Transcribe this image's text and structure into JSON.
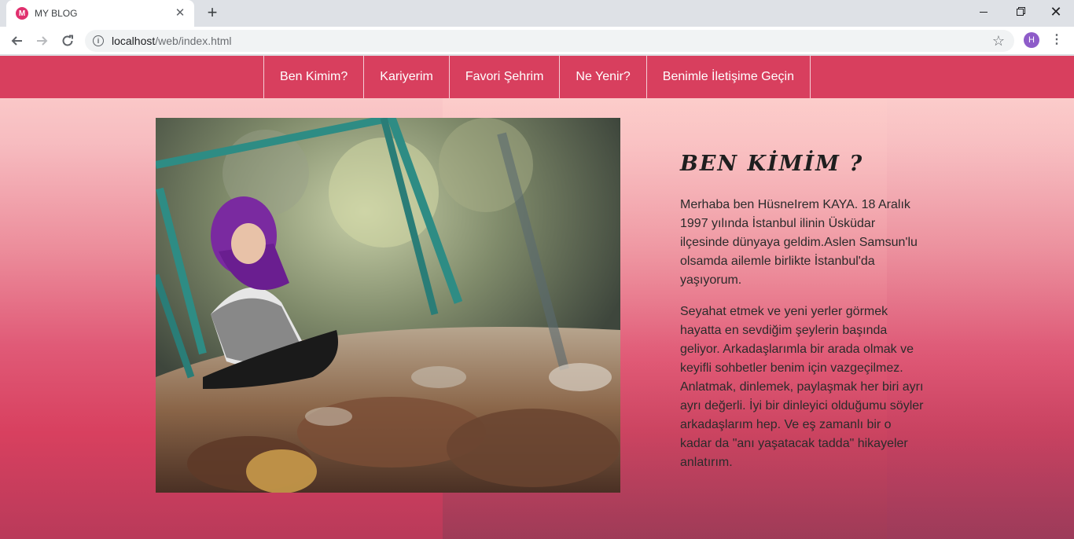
{
  "browser": {
    "tab_title": "MY BLOG",
    "favicon_letter": "M",
    "url_host": "localhost",
    "url_path": "/web/index.html",
    "profile_initial": "H"
  },
  "nav": {
    "items": [
      {
        "label": "Ben Kimim?"
      },
      {
        "label": "Kariyerim"
      },
      {
        "label": "Favori Şehrim"
      },
      {
        "label": "Ne Yenir?"
      },
      {
        "label": "Benimle İletişime Geçin"
      }
    ]
  },
  "content": {
    "heading": "BEN KİMİM ?",
    "paragraphs": [
      "Merhaba ben HüsneIrem KAYA. 18 Aralık 1997 yılında İstanbul ilinin Üsküdar ilçesinde dünyaya geldim.Aslen Samsun'lu olsamda ailemle birlikte İstanbul'da yaşıyorum.",
      "Seyahat etmek ve yeni yerler görmek hayatta en sevdiğim şeylerin başında geliyor. Arkadaşlarımla bir arada olmak ve keyifli sohbetler benim için vazgeçilmez. Anlatmak, dinlemek, paylaşmak her biri ayrı ayrı değerli. İyi bir dinleyici olduğumu söyler arkadaşlarım hep. Ve eş zamanlı bir o kadar da \"anı yaşatacak tadda\" hikayeler anlatırım."
    ]
  },
  "colors": {
    "navbar": "#d83f5e",
    "accent_hijab": "#7a2aa0"
  },
  "icons": {
    "back": "arrow-left",
    "forward": "arrow-right",
    "reload": "reload",
    "info": "info",
    "bookmark": "star",
    "menu": "kebab"
  }
}
